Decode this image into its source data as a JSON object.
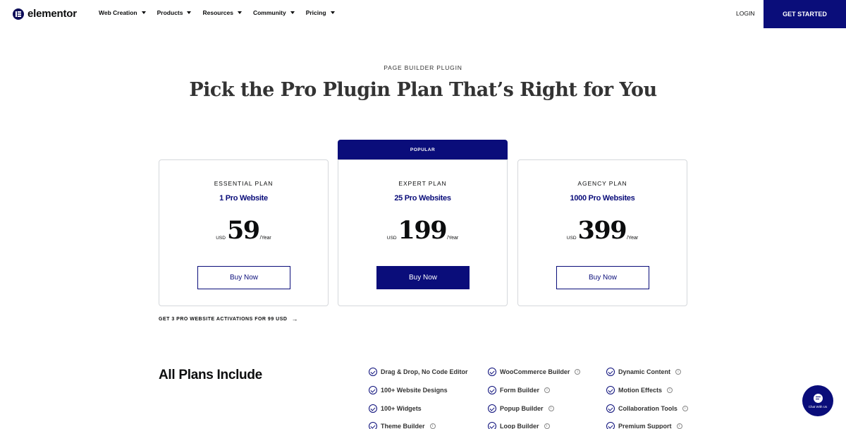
{
  "header": {
    "logo_text": "elementor",
    "nav": [
      {
        "label": "Web Creation"
      },
      {
        "label": "Products"
      },
      {
        "label": "Resources"
      },
      {
        "label": "Community"
      },
      {
        "label": "Pricing"
      }
    ],
    "login_label": "LOGIN",
    "get_started_label": "GET STARTED"
  },
  "hero": {
    "eyebrow": "PAGE BUILDER PLUGIN",
    "title": "Pick the Pro Plugin Plan That’s Right for You"
  },
  "plans": [
    {
      "name": "ESSENTIAL PLAN",
      "sites": "1 Pro Website",
      "currency": "USD",
      "price": "59",
      "period": "/Year",
      "cta": "Buy Now"
    },
    {
      "name": "EXPERT PLAN",
      "sites": "25 Pro Websites",
      "currency": "USD",
      "price": "199",
      "period": "/Year",
      "cta": "Buy Now",
      "badge": "POPULAR"
    },
    {
      "name": "AGENCY PLAN",
      "sites": "1000 Pro Websites",
      "currency": "USD",
      "price": "399",
      "period": "/Year",
      "cta": "Buy Now"
    }
  ],
  "activations_link": "GET 3 PRO WEBSITE ACTIVATIONS FOR 99  USD",
  "all_plans": {
    "title": "All Plans Include",
    "features": [
      "Drag & Drop, No Code Editor",
      "WooCommerce Builder",
      "Dynamic Content",
      "100+ Website Designs",
      "Form Builder",
      "Motion Effects",
      "100+ Widgets",
      "Popup Builder",
      "Collaboration Tools",
      "Theme Builder",
      "Loop Builder",
      "Premium Support"
    ]
  },
  "chat": {
    "label": "Chat With Us"
  },
  "colors": {
    "brand": "#0a0d7a"
  }
}
